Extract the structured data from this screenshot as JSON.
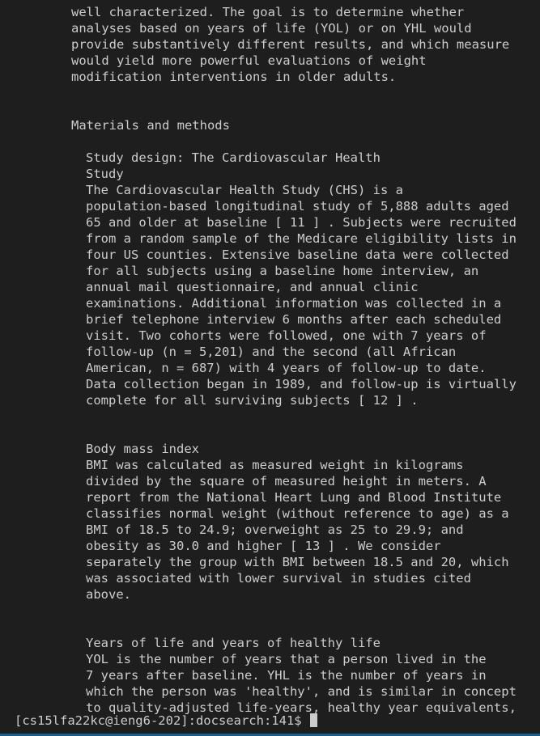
{
  "terminal": {
    "intro_lines": [
      "well characterized. The goal is to determine whether",
      "analyses based on years of life (YOL) or on YHL would",
      "provide substantively different results, and which measure",
      "would yield more powerful evaluations of weight",
      "modification interventions in older adults."
    ],
    "section_heading": "Materials and methods",
    "study_design": {
      "heading_lines": [
        "Study design: The Cardiovascular Health",
        "Study"
      ],
      "body_lines": [
        "The Cardiovascular Health Study (CHS) is a",
        "population-based longitudinal study of 5,888 adults aged",
        "65 and older at baseline [ 11 ] . Subjects were recruited",
        "from a random sample of the Medicare eligibility lists in",
        "four US counties. Extensive baseline data were collected",
        "for all subjects using a baseline home interview, an",
        "annual mail questionnaire, and annual clinic",
        "examinations. Additional information was collected in a",
        "brief telephone interview 6 months after each scheduled",
        "visit. Two cohorts were followed, one with 7 years of",
        "follow-up (n = 5,201) and the second (all African",
        "American, n = 687) with 4 years of follow-up to date.",
        "Data collection began in 1989, and follow-up is virtually",
        "complete for all surviving subjects [ 12 ] ."
      ]
    },
    "bmi": {
      "heading": "Body mass index",
      "body_lines": [
        "BMI was calculated as measured weight in kilograms",
        "divided by the square of measured height in meters. A",
        "report from the National Heart Lung and Blood Institute",
        "classifies normal weight (without reference to age) as a",
        "BMI of 18.5 to 24.9; overweight as 25 to 29.9; and",
        "obesity as 30.0 and higher [ 13 ] . We consider",
        "separately the group with BMI between 18.5 and 20, which",
        "was associated with lower survival in studies cited",
        "above."
      ]
    },
    "yol": {
      "heading": "Years of life and years of healthy life",
      "body_lines": [
        "YOL is the number of years that a person lived in the",
        "7 years after baseline. YHL is the number of years in",
        "which the person was 'healthy', and is similar in concept",
        "to quality-adjusted life-years, healthy year equivalents,"
      ]
    },
    "prompt": "[cs15lfa22kc@ieng6-202]:docsearch:141$ "
  },
  "colors": {
    "background": "#1e1e1e",
    "text": "#cccccc",
    "status_bar": "#0e639c"
  }
}
